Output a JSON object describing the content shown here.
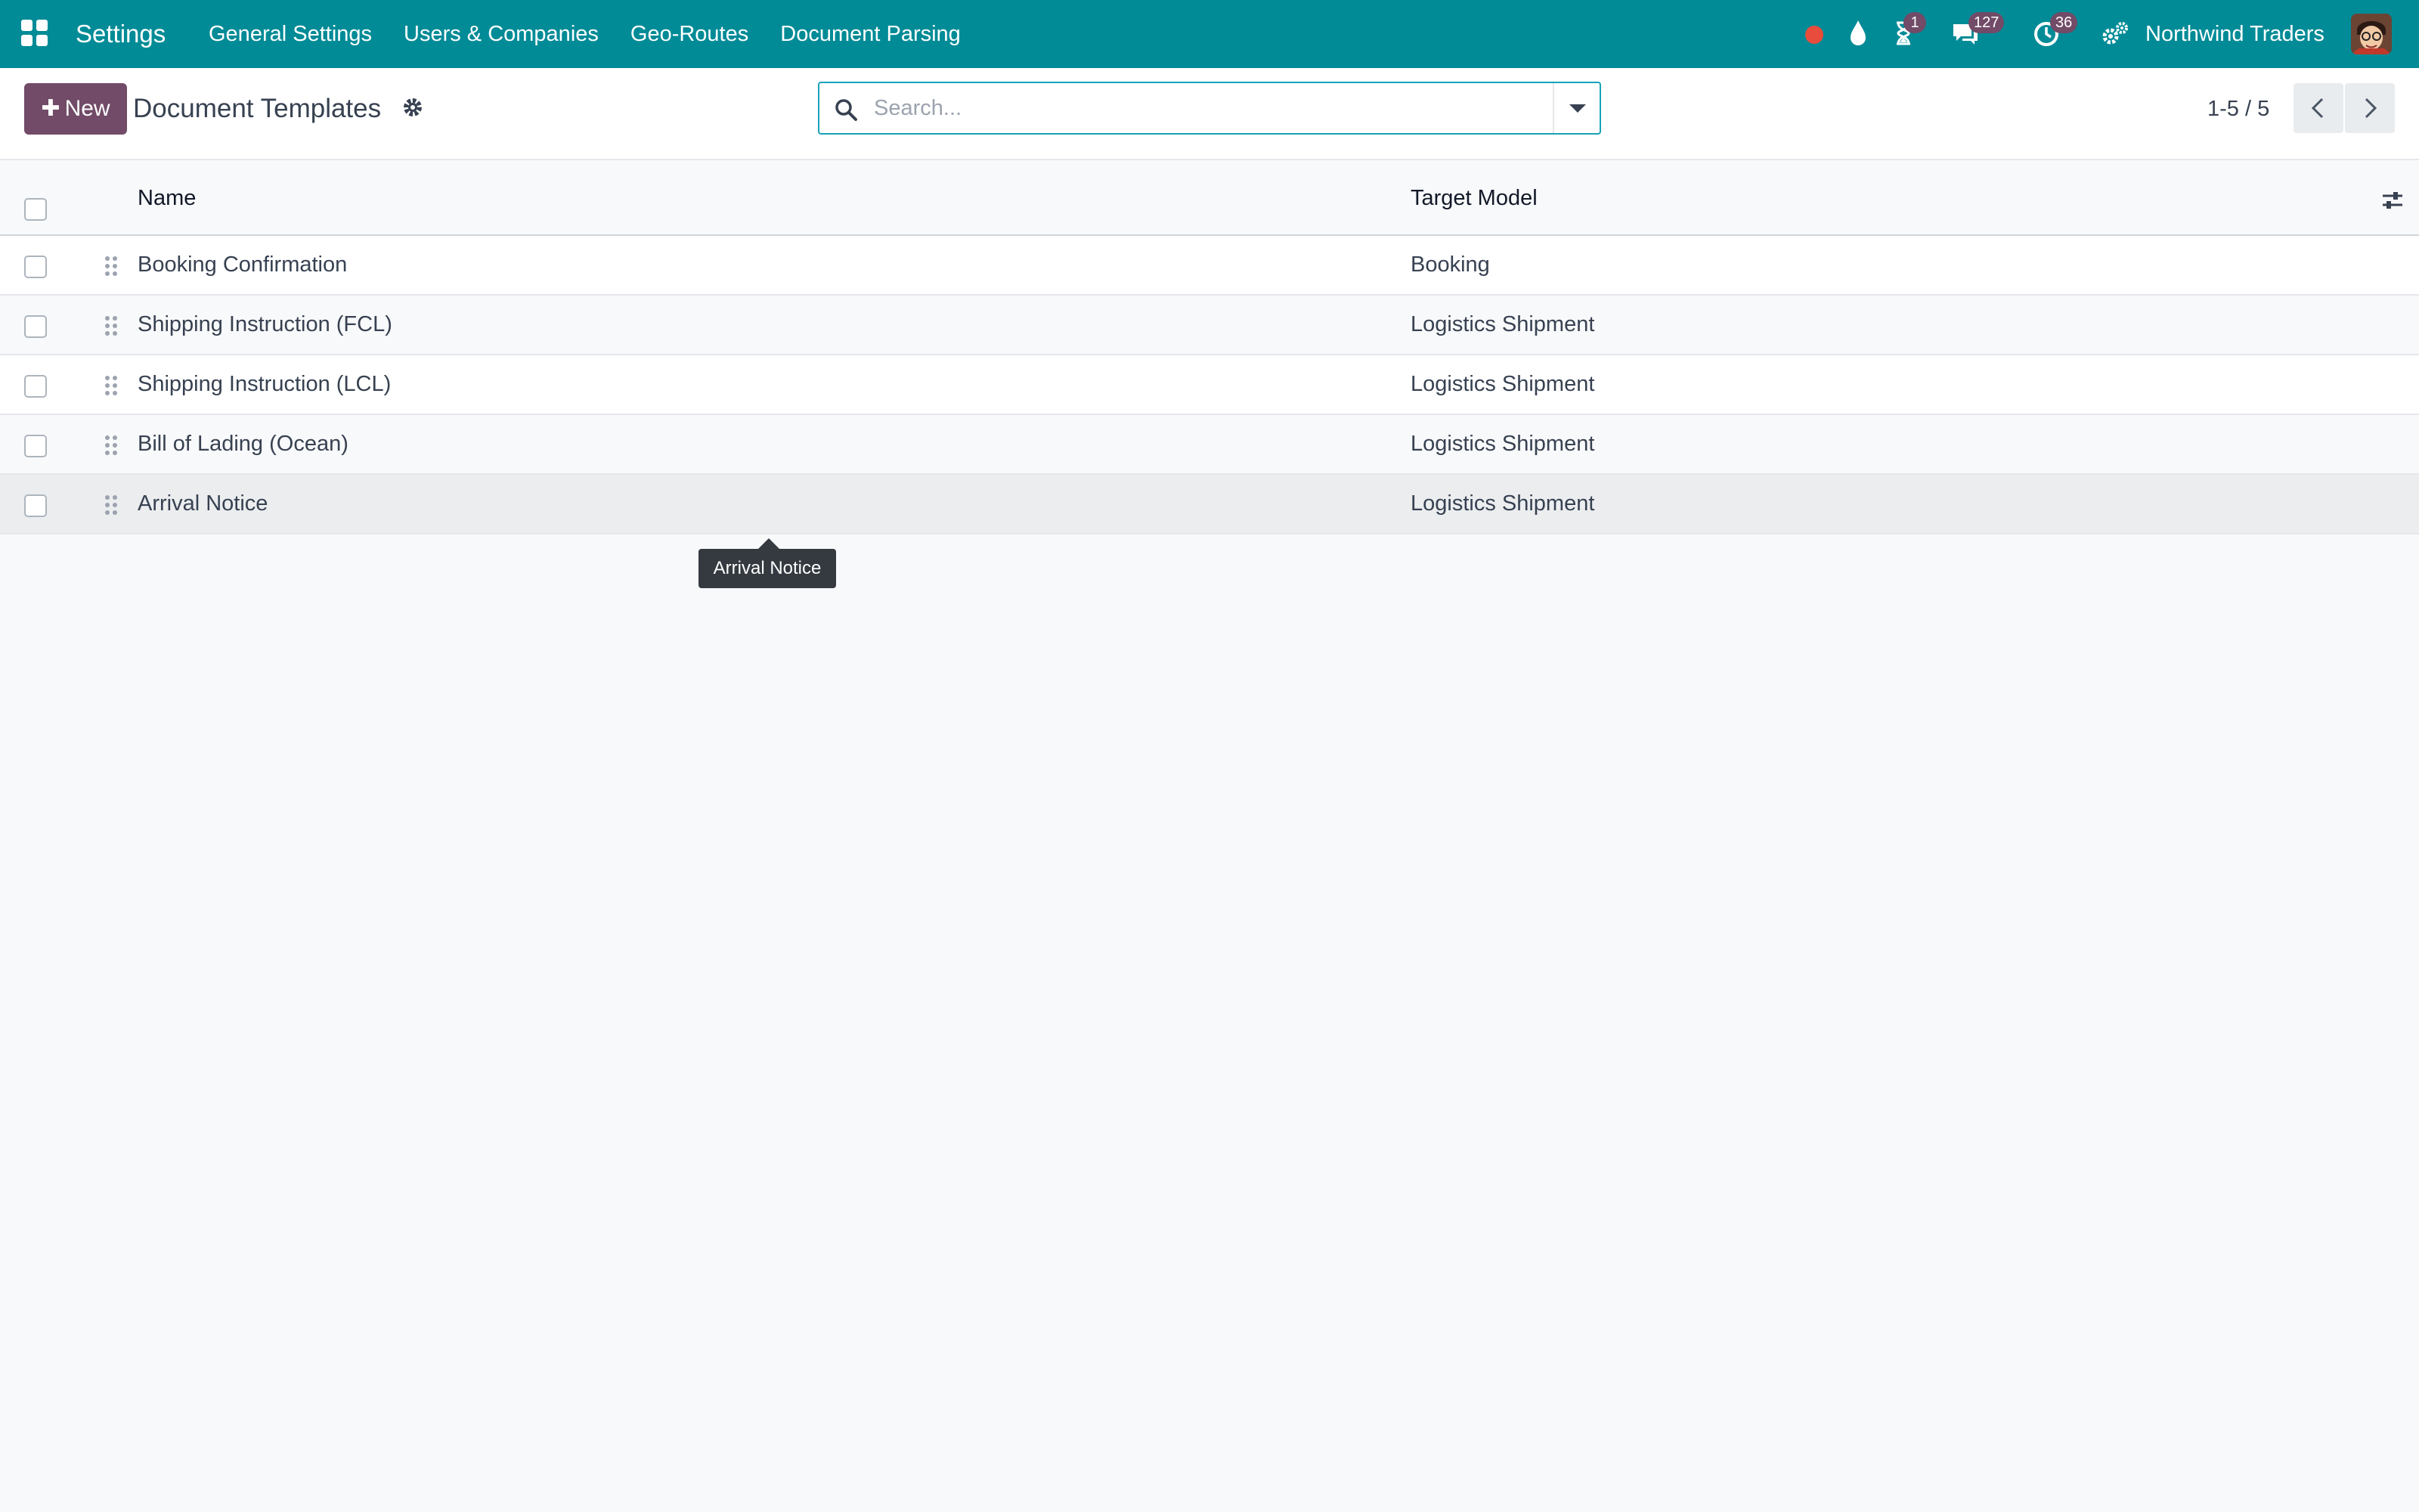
{
  "navbar": {
    "app_name": "Settings",
    "menu": [
      "General Settings",
      "Users & Companies",
      "Geo-Routes",
      "Document Parsing"
    ],
    "badges": {
      "activities": "1",
      "messages": "127",
      "clock": "36"
    },
    "company": "Northwind Traders",
    "colors": {
      "bar": "#008b97",
      "badge": "#714b67",
      "record": "#e74c3c"
    }
  },
  "control": {
    "new_label": "New",
    "title": "Document Templates",
    "search_placeholder": "Search...",
    "pager": "1-5 / 5"
  },
  "list": {
    "columns": {
      "name": "Name",
      "model": "Target Model"
    },
    "rows": [
      {
        "name": "Booking Confirmation",
        "model": "Booking"
      },
      {
        "name": "Shipping Instruction (FCL)",
        "model": "Logistics Shipment"
      },
      {
        "name": "Shipping Instruction (LCL)",
        "model": "Logistics Shipment"
      },
      {
        "name": "Bill of Lading (Ocean)",
        "model": "Logistics Shipment"
      },
      {
        "name": "Arrival Notice",
        "model": "Logistics Shipment"
      }
    ]
  },
  "tooltip": "Arrival Notice"
}
